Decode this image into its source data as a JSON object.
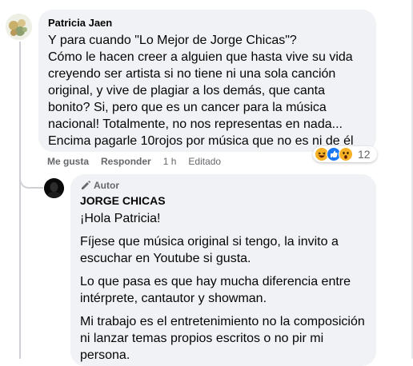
{
  "comment": {
    "author": "Patricia Jaen",
    "lines": [
      "Y para cuando \"Lo Mejor de Jorge Chicas\"?",
      "Cómo le hacen creer a alguien que hasta vive su vida creyendo ser artista si no tiene ni una sola canción original, y vive de plagiar a los demás, que canta bonito? Si, pero que es un cancer para la música nacional! Totalmente, no nos representas en nada... Encima pagarle 10rojos por música que no es ni de él"
    ],
    "actions": {
      "like": "Me gusta",
      "reply": "Responder",
      "time": "1 h",
      "edited": "Editado"
    },
    "reactions": {
      "count": "12",
      "icons": [
        "laugh-emoji",
        "like-emoji",
        "wow-emoji"
      ]
    }
  },
  "reply": {
    "badge": "Autor",
    "author": "JORGE CHICAS",
    "paragraphs": [
      "¡Hola Patricia!",
      "Fíjese que música original si tengo, la invito a escuchar en Youtube si gusta.",
      "Lo que pasa es que hay mucha diferencia entre intérprete, cantautor y showman.",
      "Mi trabajo es el entretenimiento no la composición ni lanzar temas propios escritos o no pir mi persona."
    ]
  },
  "colors": {
    "bubble": "#f0f2f5",
    "text": "#050505",
    "secondary": "#65676b",
    "like_blue": "#1877f2",
    "emoji_yellow": "#f7b125"
  }
}
